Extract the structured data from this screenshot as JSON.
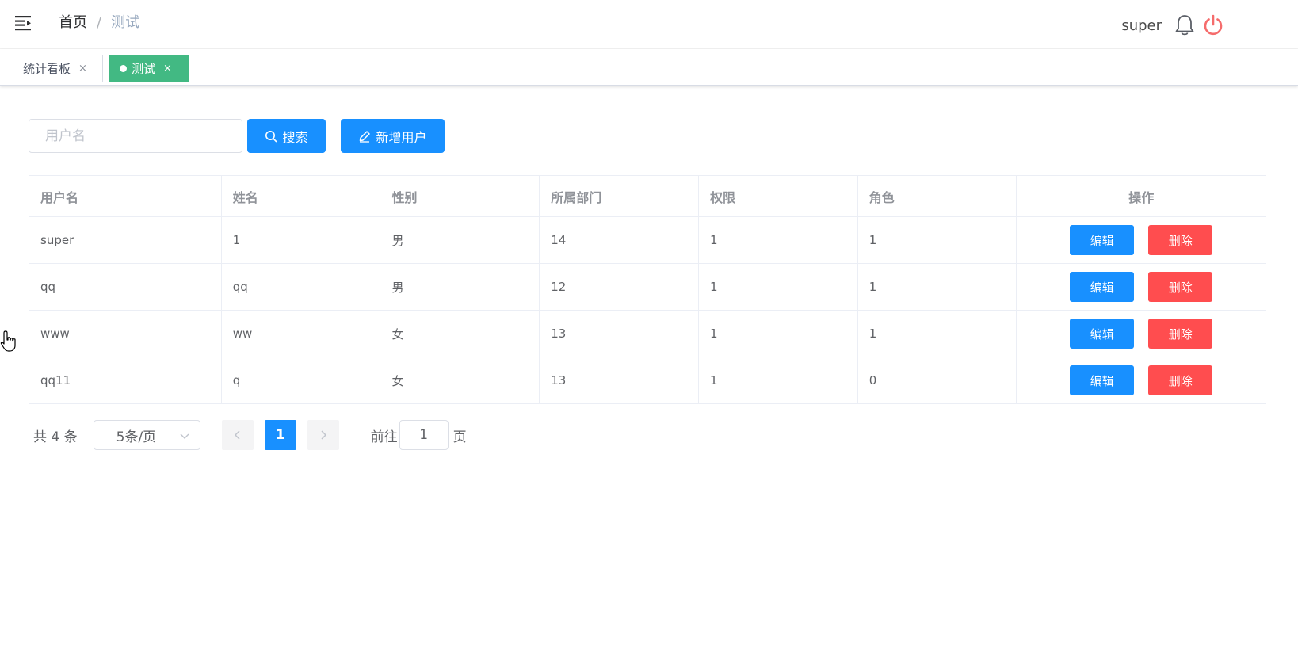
{
  "header": {
    "breadcrumb": {
      "home": "首页",
      "separator": "/",
      "current": "测试"
    },
    "username": "super",
    "icons": [
      "menu-toggle-icon",
      "bell-icon",
      "power-icon"
    ],
    "power_color": "#f56c6c"
  },
  "tags": [
    {
      "label": "统计看板",
      "close": "×",
      "active": false
    },
    {
      "label": "测试",
      "close": "×",
      "active": true
    }
  ],
  "toolbar": {
    "search_placeholder": "用户名",
    "search_label": "搜索",
    "add_label": "新增用户"
  },
  "table": {
    "columns": [
      "用户名",
      "姓名",
      "性别",
      "所属部门",
      "权限",
      "角色",
      "操作"
    ],
    "rows": [
      {
        "username": "super",
        "name": "1",
        "gender": "男",
        "dept": "14",
        "perm": "1",
        "role": "1"
      },
      {
        "username": "qq",
        "name": "qq",
        "gender": "男",
        "dept": "12",
        "perm": "1",
        "role": "1"
      },
      {
        "username": "www",
        "name": "ww",
        "gender": "女",
        "dept": "13",
        "perm": "1",
        "role": "1"
      },
      {
        "username": "qq11",
        "name": "q",
        "gender": "女",
        "dept": "13",
        "perm": "1",
        "role": "0"
      }
    ],
    "edit_label": "编辑",
    "delete_label": "删除"
  },
  "pagination": {
    "total_text": "共 4 条",
    "page_size": "5条/页",
    "current_page": "1",
    "goto_label": "前往",
    "goto_value": "1",
    "page_suffix": "页"
  },
  "colors": {
    "primary": "#1890ff",
    "danger": "#ff4d4f",
    "active_tag": "#42b983"
  }
}
